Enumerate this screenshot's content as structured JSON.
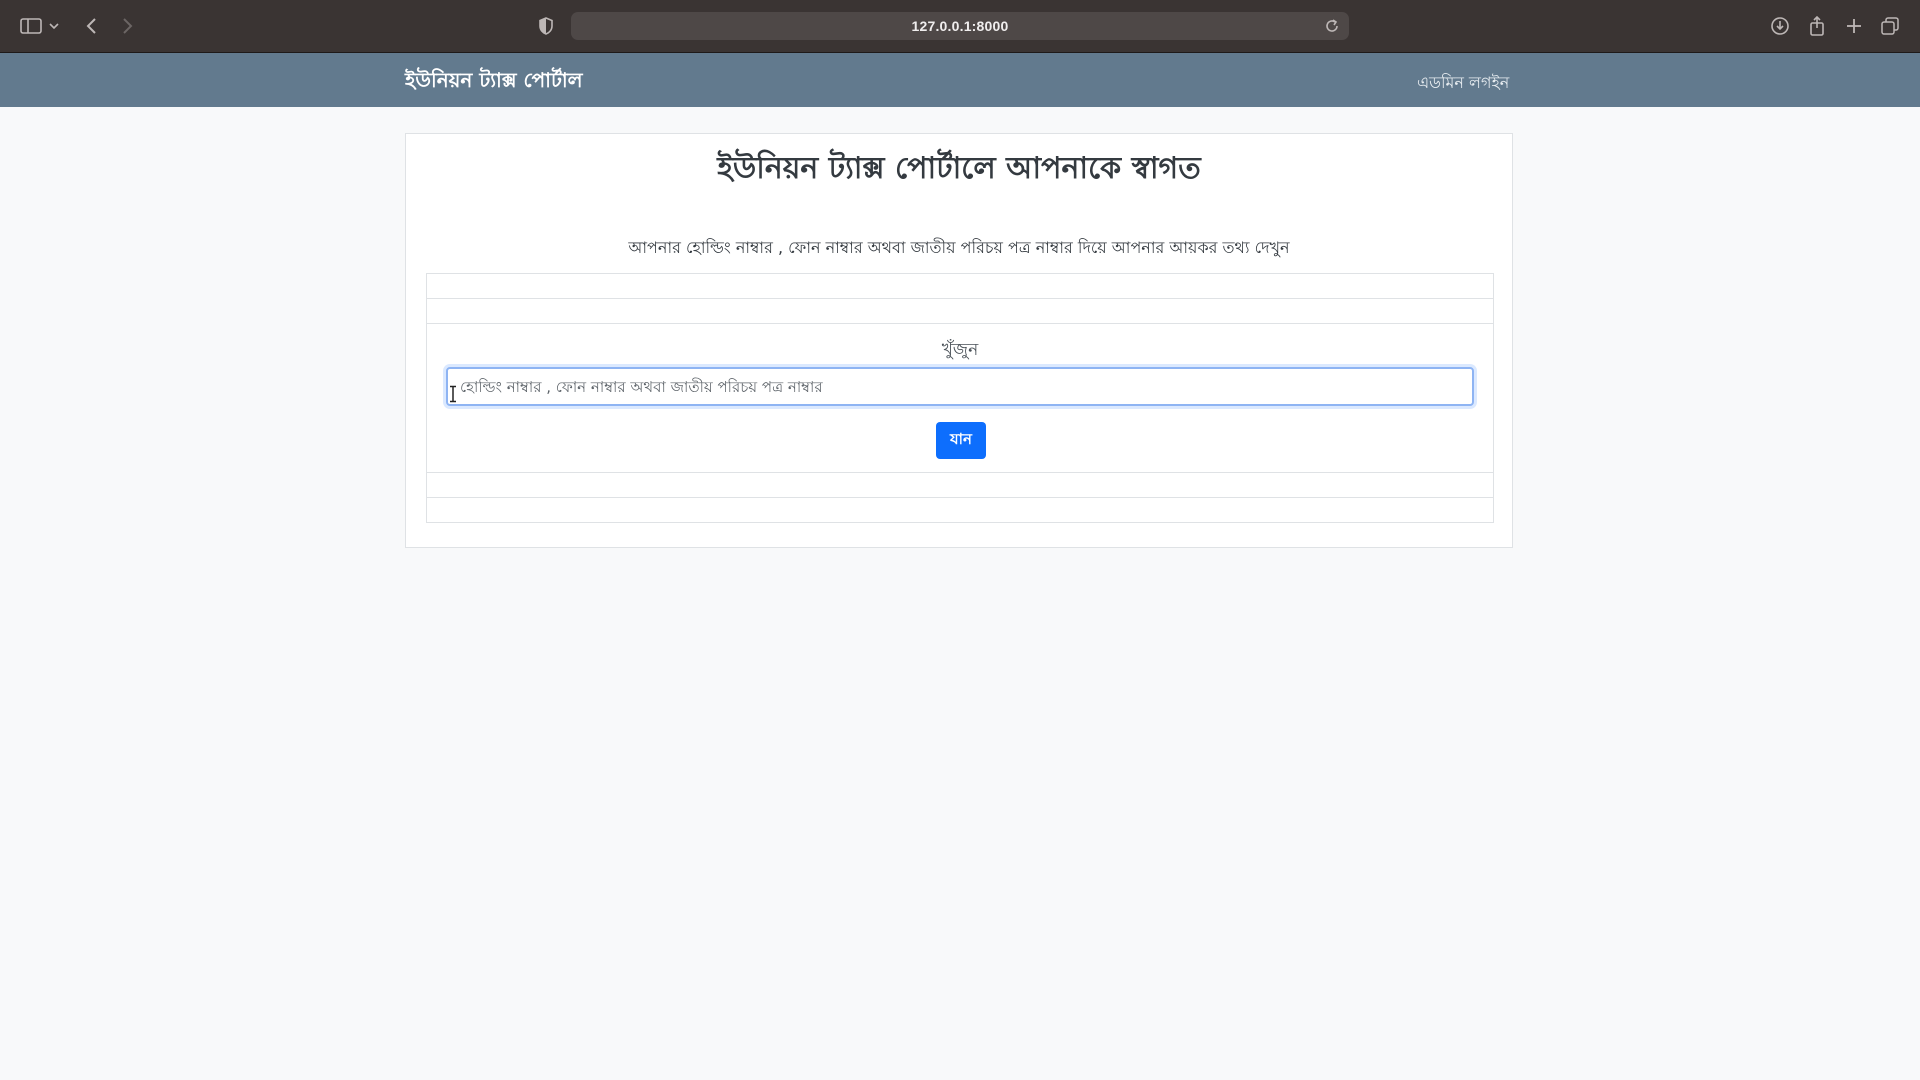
{
  "browser": {
    "url": "127.0.0.1:8000",
    "icons": [
      "sidebar-icon",
      "chevron-down-icon",
      "back-icon",
      "forward-icon",
      "shield-icon",
      "reload-icon",
      "download-icon",
      "share-icon",
      "new-tab-icon",
      "tabs-overview-icon"
    ]
  },
  "navbar": {
    "brand": "ইউনিয়ন ট্যাক্স পোর্টাল",
    "admin_login": "এডমিন লগইন"
  },
  "main": {
    "title": "ইউনিয়ন ট্যাক্স পোর্টালে আপনাকে স্বাগত",
    "subtitle": "আপনার হোল্ডিং নাম্বার , ফোন নাম্বার অথবা জাতীয় পরিচয় পত্র নাম্বার দিয়ে আপনার আয়কর তথ্য দেখুন",
    "search": {
      "label": "খুঁজুন",
      "placeholder": "হোল্ডিং নাম্বার , ফোন নাম্বার অথবা জাতীয় পরিচয় পত্র নাম্বার",
      "value": "",
      "button_label": "যান"
    }
  },
  "colors": {
    "navbar_bg": "#627a8e",
    "primary_button": "#0d6efd",
    "browser_bg": "#3a3433"
  }
}
